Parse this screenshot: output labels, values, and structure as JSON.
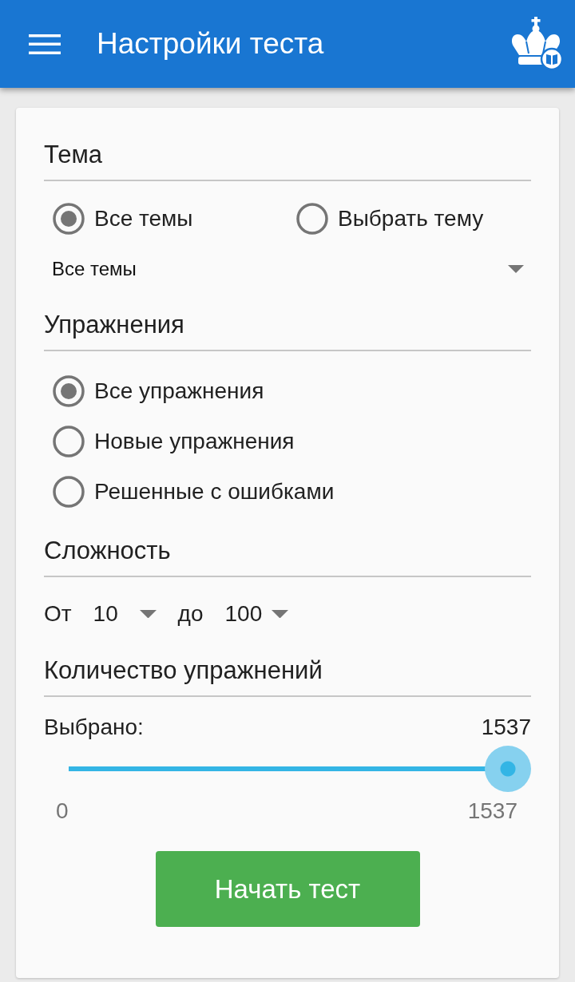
{
  "app_bar": {
    "title": "Настройки теста"
  },
  "theme": {
    "heading": "Тема",
    "options": [
      {
        "label": "Все темы",
        "selected": true
      },
      {
        "label": "Выбрать тему",
        "selected": false
      }
    ],
    "dropdown": {
      "value": "Все темы"
    }
  },
  "exercises": {
    "heading": "Упражнения",
    "options": [
      {
        "label": "Все упражнения",
        "selected": true
      },
      {
        "label": "Новые упражнения",
        "selected": false
      },
      {
        "label": "Решенные с ошибками",
        "selected": false
      }
    ]
  },
  "difficulty": {
    "heading": "Сложность",
    "from_label": "От",
    "from_value": "10",
    "to_label": "до",
    "to_value": "100"
  },
  "count": {
    "heading": "Количество упражнений",
    "selected_label": "Выбрано:",
    "selected_value": "1537",
    "slider": {
      "level": 1,
      "min_label": "0",
      "max_label": "1537"
    }
  },
  "start_button": {
    "label": "Начать тест"
  }
}
